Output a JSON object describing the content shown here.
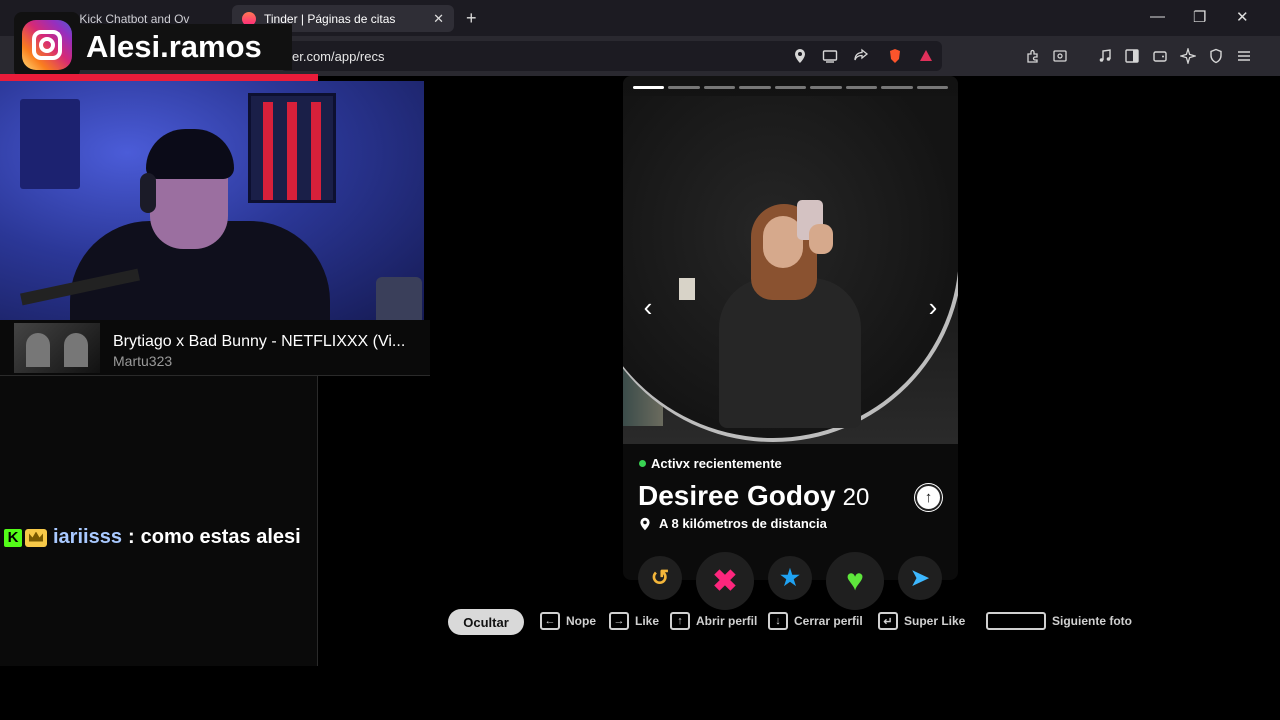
{
  "browser": {
    "tabs": [
      {
        "title": "t.app - Kick Chatbot and Ov",
        "active": false
      },
      {
        "title": "Tinder | Páginas de citas",
        "active": true
      }
    ],
    "url": "er.com/app/recs",
    "brave_badge": "1"
  },
  "overlay": {
    "instagram_handle": "Alesi.ramos",
    "now_playing": {
      "title": "Brytiago x Bad Bunny - NETFLIXXX (Vi...",
      "artist": "Martu323"
    },
    "chat": {
      "badge_k": "K",
      "user": "iariisss",
      "separator": ":",
      "message": "como estas alesi"
    }
  },
  "profile": {
    "status": "Activx recientemente",
    "name": "Desiree Godoy",
    "age": "20",
    "distance": "A 8 kilómetros de distancia",
    "photo_count": 9,
    "current_photo": 1
  },
  "shortcuts": {
    "hide_label": "Ocultar",
    "items": [
      {
        "key": "←",
        "label": "Nope"
      },
      {
        "key": "→",
        "label": "Like"
      },
      {
        "key": "↑",
        "label": "Abrir perfil"
      },
      {
        "key": "↓",
        "label": "Cerrar perfil"
      },
      {
        "key": "↵",
        "label": "Super Like"
      },
      {
        "key": "",
        "label": "Siguiente foto"
      }
    ]
  },
  "colors": {
    "rewind": "#f4b63a",
    "nope": "#fd267d",
    "superlike": "#1fa2f2",
    "like": "#5ee63c",
    "boost": "#3db8ff",
    "live_red": "#ea1c3a",
    "kick_green": "#53fc18"
  }
}
